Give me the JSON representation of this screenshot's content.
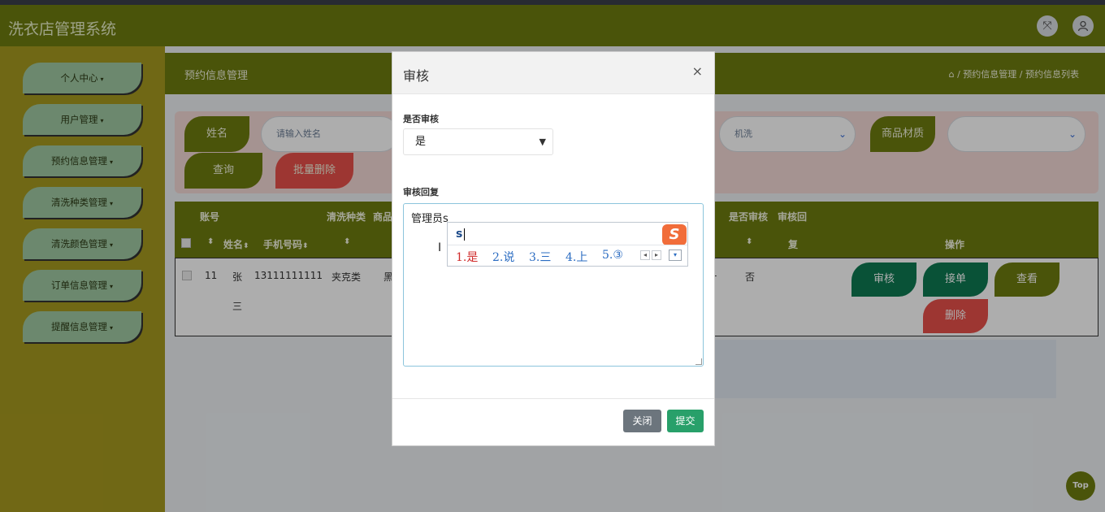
{
  "app": {
    "title": "洗衣店管理系统"
  },
  "header_icons": {
    "fullscreen": "expand-icon",
    "profile": "user-icon"
  },
  "sidebar": {
    "items": [
      {
        "label": "个人中心"
      },
      {
        "label": "用户管理"
      },
      {
        "label": "预约信息管理"
      },
      {
        "label": "清洗种类管理"
      },
      {
        "label": "清洗颜色管理"
      },
      {
        "label": "订单信息管理"
      },
      {
        "label": "提醒信息管理"
      }
    ]
  },
  "page": {
    "title": "预约信息管理",
    "breadcrumb": "/ 预约信息管理 / 预约信息列表"
  },
  "search": {
    "name_label": "姓名",
    "name_placeholder": "请输入姓名",
    "wash_method_value": "机洗",
    "material_label": "商品材质",
    "query_label": "查询",
    "batch_delete_label": "批量删除"
  },
  "table": {
    "header_row1": {
      "account": "账号",
      "wash_type": "清洗种类",
      "goods": "商品",
      "is_reviewed": "是否审核",
      "review_reply_a": "审核回"
    },
    "header_row2": {
      "name": "姓名",
      "phone": "手机号码",
      "review_reply_b": "复",
      "actions": "操作"
    },
    "row": {
      "account": "11",
      "name_a": "张",
      "name_b": "三",
      "phone": "13111111111",
      "wash_type": "夹克类",
      "goods_partial": "黑",
      "dash": "-",
      "is_reviewed": "否",
      "actions": {
        "review": "审核",
        "accept": "接单",
        "view": "查看",
        "delete": "删除"
      }
    }
  },
  "modal": {
    "title": "审核",
    "close_glyph": "×",
    "review_label": "是否审核",
    "review_value": "是",
    "reply_label": "审核回复",
    "reply_value": "管理员s",
    "close_button": "关闭",
    "submit_button": "提交"
  },
  "ime": {
    "input": "s",
    "logo": "S",
    "candidates": [
      "1.是",
      "2.说",
      "3.三",
      "4.上",
      "5.③"
    ]
  },
  "top_button": "Top",
  "colors": {
    "primary": "#6e7c0f",
    "sidebar": "#a69a1f",
    "danger": "#e8504a",
    "review": "#0e7a52",
    "accept": "#0e7a52",
    "submit": "#28a06a"
  }
}
